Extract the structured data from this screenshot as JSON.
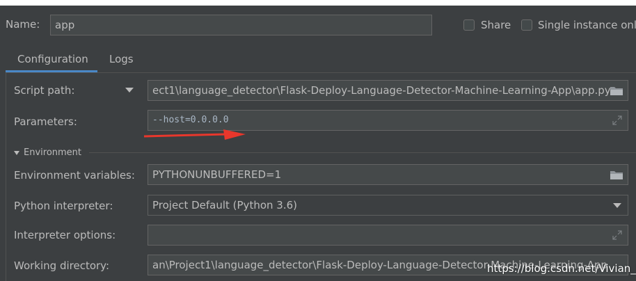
{
  "header": {
    "name_label": "Name:",
    "name_value": "app",
    "share_label": "Share",
    "single_instance_label": "Single instance only"
  },
  "tabs": [
    {
      "label": "Configuration"
    },
    {
      "label": "Logs"
    }
  ],
  "form": {
    "script_path_label": "Script path:",
    "script_path_value": "ect1\\language_detector\\Flask-Deploy-Language-Detector-Machine-Learning-App\\app.py",
    "parameters_label": "Parameters:",
    "parameters_value": "--host=0.0.0.0",
    "environment_section": "Environment",
    "env_vars_label": "Environment variables:",
    "env_vars_value": "PYTHONUNBUFFERED=1",
    "python_interpreter_label": "Python interpreter:",
    "python_interpreter_value": "Project Default (Python 3.6)",
    "interpreter_options_label": "Interpreter options:",
    "interpreter_options_value": "",
    "working_directory_label": "Working directory:",
    "working_directory_value": "an\\Project1\\language_detector\\Flask-Deploy-Language-Detector-Machine-Learning-App"
  },
  "watermark": "https://blog.csdn.net/Vivian_ll",
  "colors": {
    "background": "#3c3f41",
    "field": "#45494a",
    "accent_tab": "#4a88c7",
    "arrow": "#e8372c"
  }
}
